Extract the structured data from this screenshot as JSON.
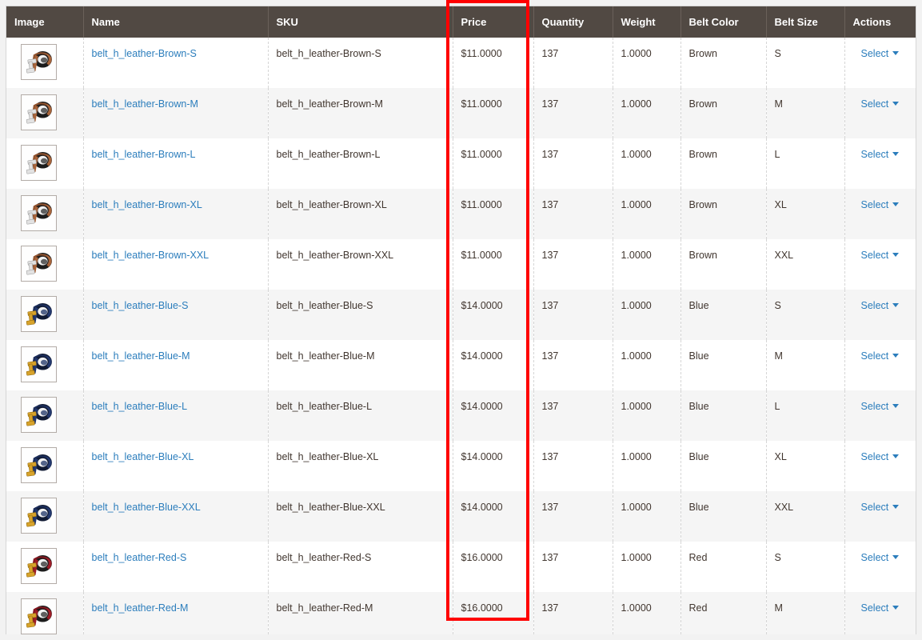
{
  "grid": {
    "columns": [
      {
        "key": "image",
        "label": "Image"
      },
      {
        "key": "name",
        "label": "Name"
      },
      {
        "key": "sku",
        "label": "SKU"
      },
      {
        "key": "price",
        "label": "Price"
      },
      {
        "key": "quantity",
        "label": "Quantity"
      },
      {
        "key": "weight",
        "label": "Weight"
      },
      {
        "key": "color",
        "label": "Belt Color"
      },
      {
        "key": "size",
        "label": "Belt Size"
      },
      {
        "key": "actions",
        "label": "Actions"
      }
    ],
    "action_label": "Select",
    "rows": [
      {
        "image": "belt-brown-thumbnail",
        "name": "belt_h_leather-Brown-S",
        "sku": "belt_h_leather-Brown-S",
        "price": "$11.0000",
        "quantity": "137",
        "weight": "1.0000",
        "color": "Brown",
        "size": "S",
        "action": "Select"
      },
      {
        "image": "belt-brown-thumbnail",
        "name": "belt_h_leather-Brown-M",
        "sku": "belt_h_leather-Brown-M",
        "price": "$11.0000",
        "quantity": "137",
        "weight": "1.0000",
        "color": "Brown",
        "size": "M",
        "action": "Select"
      },
      {
        "image": "belt-brown-thumbnail",
        "name": "belt_h_leather-Brown-L",
        "sku": "belt_h_leather-Brown-L",
        "price": "$11.0000",
        "quantity": "137",
        "weight": "1.0000",
        "color": "Brown",
        "size": "L",
        "action": "Select"
      },
      {
        "image": "belt-brown-thumbnail",
        "name": "belt_h_leather-Brown-XL",
        "sku": "belt_h_leather-Brown-XL",
        "price": "$11.0000",
        "quantity": "137",
        "weight": "1.0000",
        "color": "Brown",
        "size": "XL",
        "action": "Select"
      },
      {
        "image": "belt-brown-thumbnail",
        "name": "belt_h_leather-Brown-XXL",
        "sku": "belt_h_leather-Brown-XXL",
        "price": "$11.0000",
        "quantity": "137",
        "weight": "1.0000",
        "color": "Brown",
        "size": "XXL",
        "action": "Select"
      },
      {
        "image": "belt-blue-thumbnail",
        "name": "belt_h_leather-Blue-S",
        "sku": "belt_h_leather-Blue-S",
        "price": "$14.0000",
        "quantity": "137",
        "weight": "1.0000",
        "color": "Blue",
        "size": "S",
        "action": "Select"
      },
      {
        "image": "belt-blue-thumbnail",
        "name": "belt_h_leather-Blue-M",
        "sku": "belt_h_leather-Blue-M",
        "price": "$14.0000",
        "quantity": "137",
        "weight": "1.0000",
        "color": "Blue",
        "size": "M",
        "action": "Select"
      },
      {
        "image": "belt-blue-thumbnail",
        "name": "belt_h_leather-Blue-L",
        "sku": "belt_h_leather-Blue-L",
        "price": "$14.0000",
        "quantity": "137",
        "weight": "1.0000",
        "color": "Blue",
        "size": "L",
        "action": "Select"
      },
      {
        "image": "belt-blue-thumbnail",
        "name": "belt_h_leather-Blue-XL",
        "sku": "belt_h_leather-Blue-XL",
        "price": "$14.0000",
        "quantity": "137",
        "weight": "1.0000",
        "color": "Blue",
        "size": "XL",
        "action": "Select"
      },
      {
        "image": "belt-blue-thumbnail",
        "name": "belt_h_leather-Blue-XXL",
        "sku": "belt_h_leather-Blue-XXL",
        "price": "$14.0000",
        "quantity": "137",
        "weight": "1.0000",
        "color": "Blue",
        "size": "XXL",
        "action": "Select"
      },
      {
        "image": "belt-red-thumbnail",
        "name": "belt_h_leather-Red-S",
        "sku": "belt_h_leather-Red-S",
        "price": "$16.0000",
        "quantity": "137",
        "weight": "1.0000",
        "color": "Red",
        "size": "S",
        "action": "Select"
      },
      {
        "image": "belt-red-thumbnail",
        "name": "belt_h_leather-Red-M",
        "sku": "belt_h_leather-Red-M",
        "price": "$16.0000",
        "quantity": "137",
        "weight": "1.0000",
        "color": "Red",
        "size": "M",
        "action": "Select"
      }
    ]
  },
  "annotation": {
    "type": "highlight-rectangle",
    "target_column": "Price",
    "color": "#ff0000"
  },
  "colors": {
    "header_bg": "#514943",
    "link": "#2b7dbc",
    "row_alt_bg": "#f5f5f5",
    "page_bg": "#f2f2f2",
    "text": "#41362f"
  }
}
